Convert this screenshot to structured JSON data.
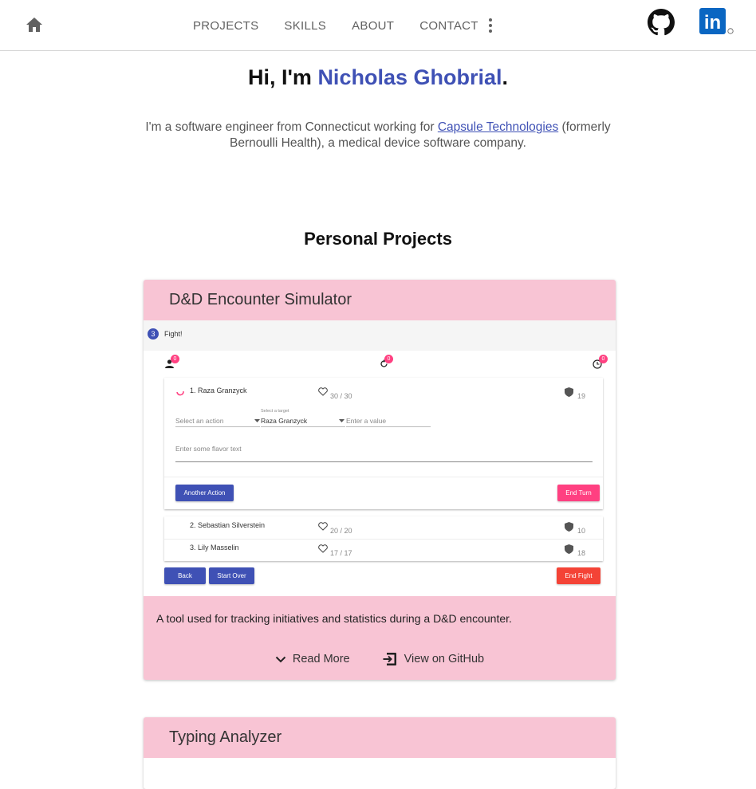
{
  "nav": {
    "home_icon": "home-icon",
    "links": [
      "PROJECTS",
      "SKILLS",
      "ABOUT",
      "CONTACT"
    ],
    "more_icon": "more-vertical-icon",
    "github_icon": "github-icon",
    "linkedin_icon": "linkedin-icon",
    "linkedin_text": "in"
  },
  "hero": {
    "greeting": "Hi, I'm ",
    "name": "Nicholas Ghobrial",
    "period": ".",
    "desc_before": "I'm a software engineer from Connecticut working for ",
    "company_link": "Capsule Technologies",
    "desc_after": " (formerly Bernoulli Health), a medical device software company."
  },
  "section": {
    "title": "Personal Projects"
  },
  "projects": [
    {
      "title": "D&D Encounter Simulator",
      "description": "A tool used for tracking initiatives and statistics during a D&D encounter.",
      "read_more": "Read More",
      "view_github": "View on GitHub",
      "screenshot": {
        "step_number": "3",
        "step_label": "Fight!",
        "badges": [
          "0",
          "0",
          "0"
        ],
        "active": {
          "name": "1. Raza Granzyck",
          "hp": "30 / 30",
          "ac": "19",
          "action_placeholder": "Select an action",
          "target_label": "Select a target",
          "target_value": "Raza Granzyck",
          "value_placeholder": "Enter a value",
          "flavor_placeholder": "Enter some flavor text",
          "another_action": "Another Action",
          "end_turn": "End Turn"
        },
        "others": [
          {
            "name": "2. Sebastian Silverstein",
            "hp": "20 / 20",
            "ac": "10"
          },
          {
            "name": "3. Lily Masselin",
            "hp": "17 / 17",
            "ac": "18"
          }
        ],
        "back": "Back",
        "start_over": "Start Over",
        "end_fight": "End Fight"
      }
    },
    {
      "title": "Typing Analyzer"
    }
  ],
  "colors": {
    "accent": "#3f51b5",
    "card_bg": "#f8c4d4",
    "pink": "#ff4081",
    "red": "#f44336"
  }
}
